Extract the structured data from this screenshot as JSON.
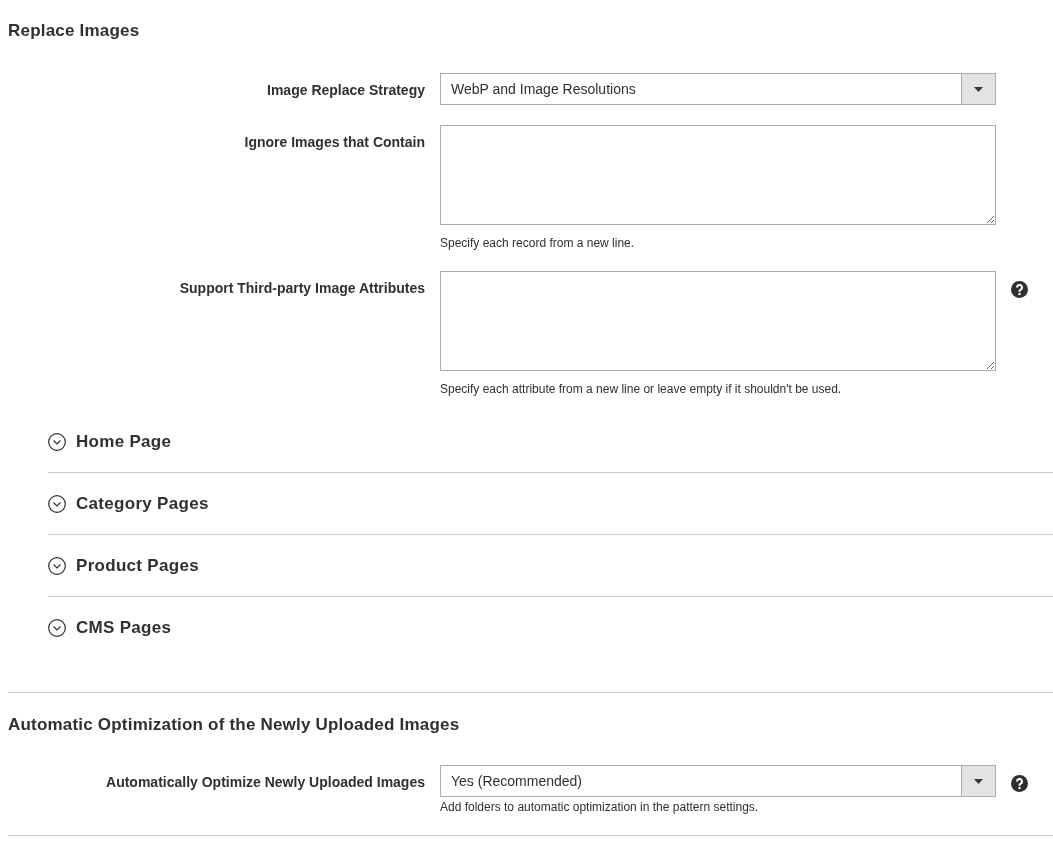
{
  "sections": [
    {
      "title": "Replace Images",
      "fields": [
        {
          "kind": "select",
          "label": "Image Replace Strategy",
          "value": "WebP and Image Resolutions",
          "help": false
        },
        {
          "kind": "textarea",
          "label": "Ignore Images that Contain",
          "hint": "Specify each record from a new line.",
          "help": false
        },
        {
          "kind": "textarea",
          "label": "Support Third-party Image Attributes",
          "hint": "Specify each attribute from a new line or leave empty if it shouldn't be used.",
          "help": true
        }
      ],
      "groups": [
        {
          "title": "Home Page",
          "expanded": false
        },
        {
          "title": "Category Pages",
          "expanded": false
        },
        {
          "title": "Product Pages",
          "expanded": false
        },
        {
          "title": "CMS Pages",
          "expanded": false
        }
      ]
    },
    {
      "title": "Automatic Optimization of the Newly Uploaded Images",
      "fields": [
        {
          "kind": "select",
          "label": "Automatically Optimize Newly Uploaded Images",
          "value": "Yes (Recommended)",
          "hint": "Add folders to automatic optimization in the pattern settings.",
          "help": true
        }
      ]
    }
  ]
}
